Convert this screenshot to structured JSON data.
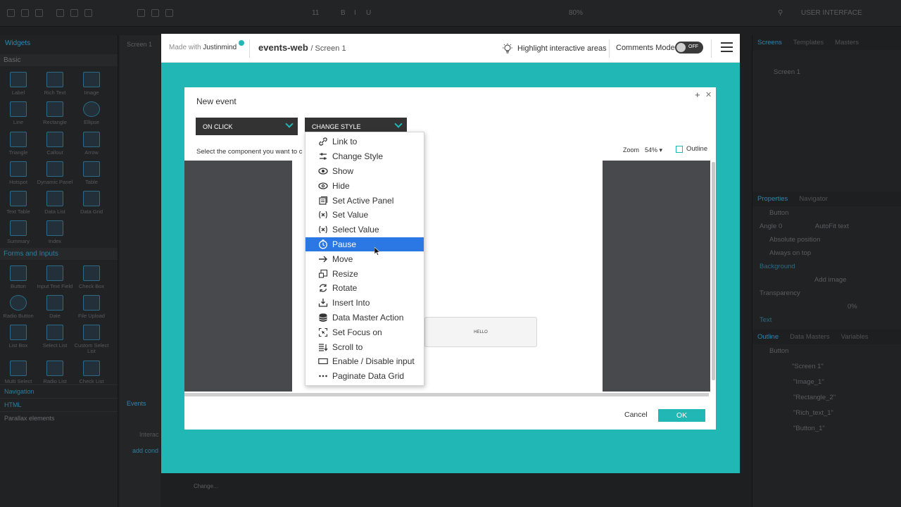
{
  "ide": {
    "topbar": {
      "font_size": "11",
      "zoom": "80%",
      "workspace": "USER INTERFACE"
    },
    "left": {
      "widgets_title": "Widgets",
      "section_basic": "Basic",
      "widgets": [
        "Label",
        "Rich Text",
        "Image",
        "Line",
        "Rectangle",
        "Ellipse",
        "Triangle",
        "Callout",
        "Arrow",
        "Hotspot",
        "Dynamic Panel",
        "Table",
        "Text Table",
        "Data List",
        "Data Grid",
        "Summary",
        "Index"
      ],
      "section_forms": "Forms and Inputs",
      "form_widgets": [
        "Button",
        "Input Text Field",
        "Check Box",
        "Radio Button",
        "Date",
        "File Upload",
        "List Box",
        "Select List",
        "Custom Select List",
        "Multi Select",
        "Radio List",
        "Check List"
      ],
      "sections": [
        "Navigation",
        "HTML",
        "Parallax elements"
      ]
    },
    "canvas": {
      "screen_tab": "Screen 1",
      "events_tab": "Events",
      "interaction": "Interac",
      "add_condition": "add cond",
      "change_label": "Change..."
    },
    "right": {
      "tabs": [
        "Screens",
        "Templates",
        "Masters"
      ],
      "screen_item": "Screen 1",
      "props_tabs": [
        "Properties",
        "Navigator"
      ],
      "selected": "Button",
      "angle_label": "Angle",
      "angle_value": "0",
      "autofit": "AutoFit text",
      "absolute": "Absolute position",
      "always_top": "Always on top",
      "background": "Background",
      "add_image": "Add image",
      "transparency": "Transparency",
      "transparency_value": "0%",
      "text": "Text",
      "outline_tabs": [
        "Outline",
        "Data Masters",
        "Variables"
      ],
      "outline_items": [
        "Button",
        "\"Screen 1\"",
        "\"Image_1\"",
        "\"Rectangle_2\"",
        "\"Rich_text_1\"",
        "\"Button_1\""
      ]
    }
  },
  "proto": {
    "made_with": "Made with",
    "brand": "Justinmind",
    "project": "events-web",
    "screen": "/ Screen 1",
    "highlight": "Highlight interactive areas",
    "comments_mode": "Comments Mode",
    "toggle": "OFF"
  },
  "dialog": {
    "title": "New event",
    "trigger": "ON CLICK",
    "action": "CHANGE STYLE",
    "select_text": "Select the component you want to c",
    "zoom_label": "Zoom",
    "zoom_value": "54% ▾",
    "outline": "Outline",
    "preview_button": "HELLO",
    "cancel": "Cancel",
    "ok": "OK"
  },
  "menu": {
    "items": [
      {
        "label": "Link to",
        "icon": "link-icon"
      },
      {
        "label": "Change Style",
        "icon": "sliders-icon"
      },
      {
        "label": "Show",
        "icon": "eye-icon"
      },
      {
        "label": "Hide",
        "icon": "eye-hide-icon"
      },
      {
        "label": "Set Active Panel",
        "icon": "panel-icon"
      },
      {
        "label": "Set Value",
        "icon": "x-paren-icon"
      },
      {
        "label": "Select Value",
        "icon": "x-check-icon"
      },
      {
        "label": "Pause",
        "icon": "clock-icon"
      },
      {
        "label": "Move",
        "icon": "arrow-right-icon"
      },
      {
        "label": "Resize",
        "icon": "resize-icon"
      },
      {
        "label": "Rotate",
        "icon": "rotate-icon"
      },
      {
        "label": "Insert Into",
        "icon": "insert-icon"
      },
      {
        "label": "Data Master Action",
        "icon": "database-icon"
      },
      {
        "label": "Set Focus on",
        "icon": "focus-icon"
      },
      {
        "label": "Scroll to",
        "icon": "scroll-icon"
      },
      {
        "label": "Enable / Disable input",
        "icon": "input-icon"
      },
      {
        "label": "Paginate Data Grid",
        "icon": "dots-icon"
      }
    ],
    "selected_index": 7,
    "accent": "#2b78e4"
  },
  "colors": {
    "teal": "#20b7b5",
    "dark": "#333333",
    "ide_bg": "#1d1f21"
  }
}
